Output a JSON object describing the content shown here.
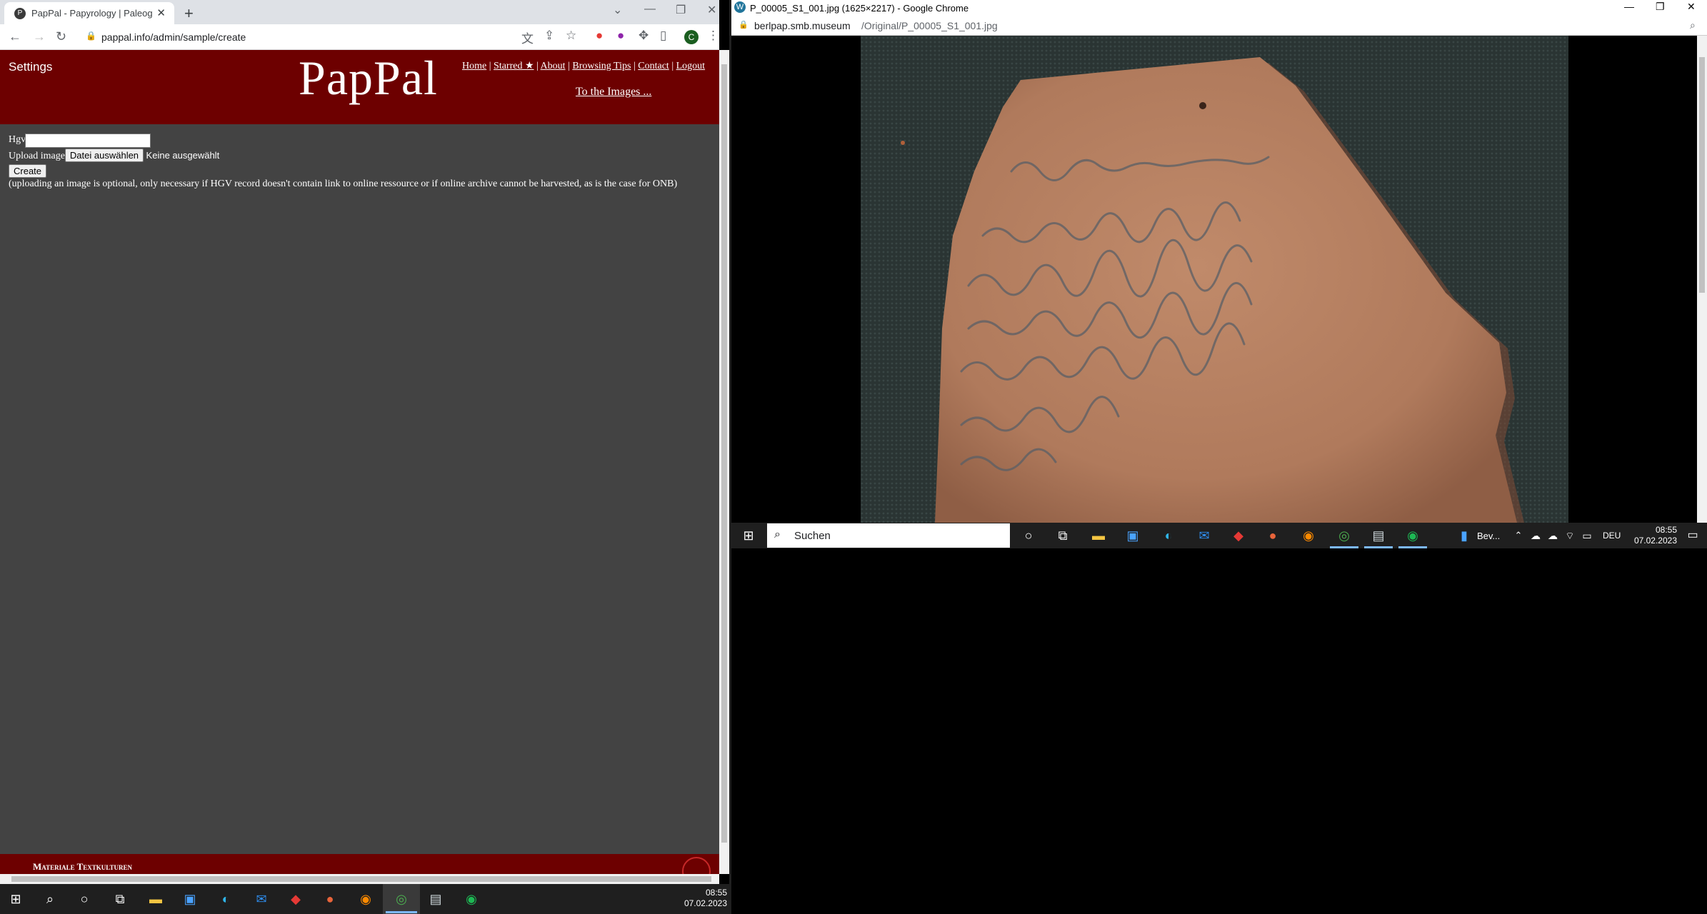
{
  "left_browser": {
    "tab_title": "PapPal - Papyrology | Paleograph",
    "url": "pappal.info/admin/sample/create",
    "profile_initial": "C"
  },
  "page": {
    "settings": "Settings",
    "logo": "PapPal",
    "nav": [
      "Home",
      "Starred ★",
      "About",
      "Browsing Tips",
      "Contact",
      "Logout"
    ],
    "to_images": "To the Images ...",
    "form": {
      "hgv_label": "Hgv",
      "upload_label": "Upload image",
      "file_button": "Datei auswählen",
      "file_status": "Keine ausgewählt",
      "create_button": "Create",
      "note": "(uploading an image is optional, only necessary if HGV record doesn't contain link to online ressource or if online archive cannot be harvested, as is the case for ONB)"
    },
    "footer": "Materiale Textkulturen"
  },
  "right_browser": {
    "title": "P_00005_S1_001.jpg (1625×2217) - Google Chrome",
    "url_host": "berlpap.smb.museum",
    "url_path": "/Original/P_00005_S1_001.jpg"
  },
  "taskbar_right": {
    "search_placeholder": "Suchen",
    "pinned_label": "Bev...",
    "lang": "DEU",
    "time": "08:55",
    "date": "07.02.2023"
  },
  "taskbar_left": {
    "time": "08:55",
    "date": "07.02.2023"
  }
}
